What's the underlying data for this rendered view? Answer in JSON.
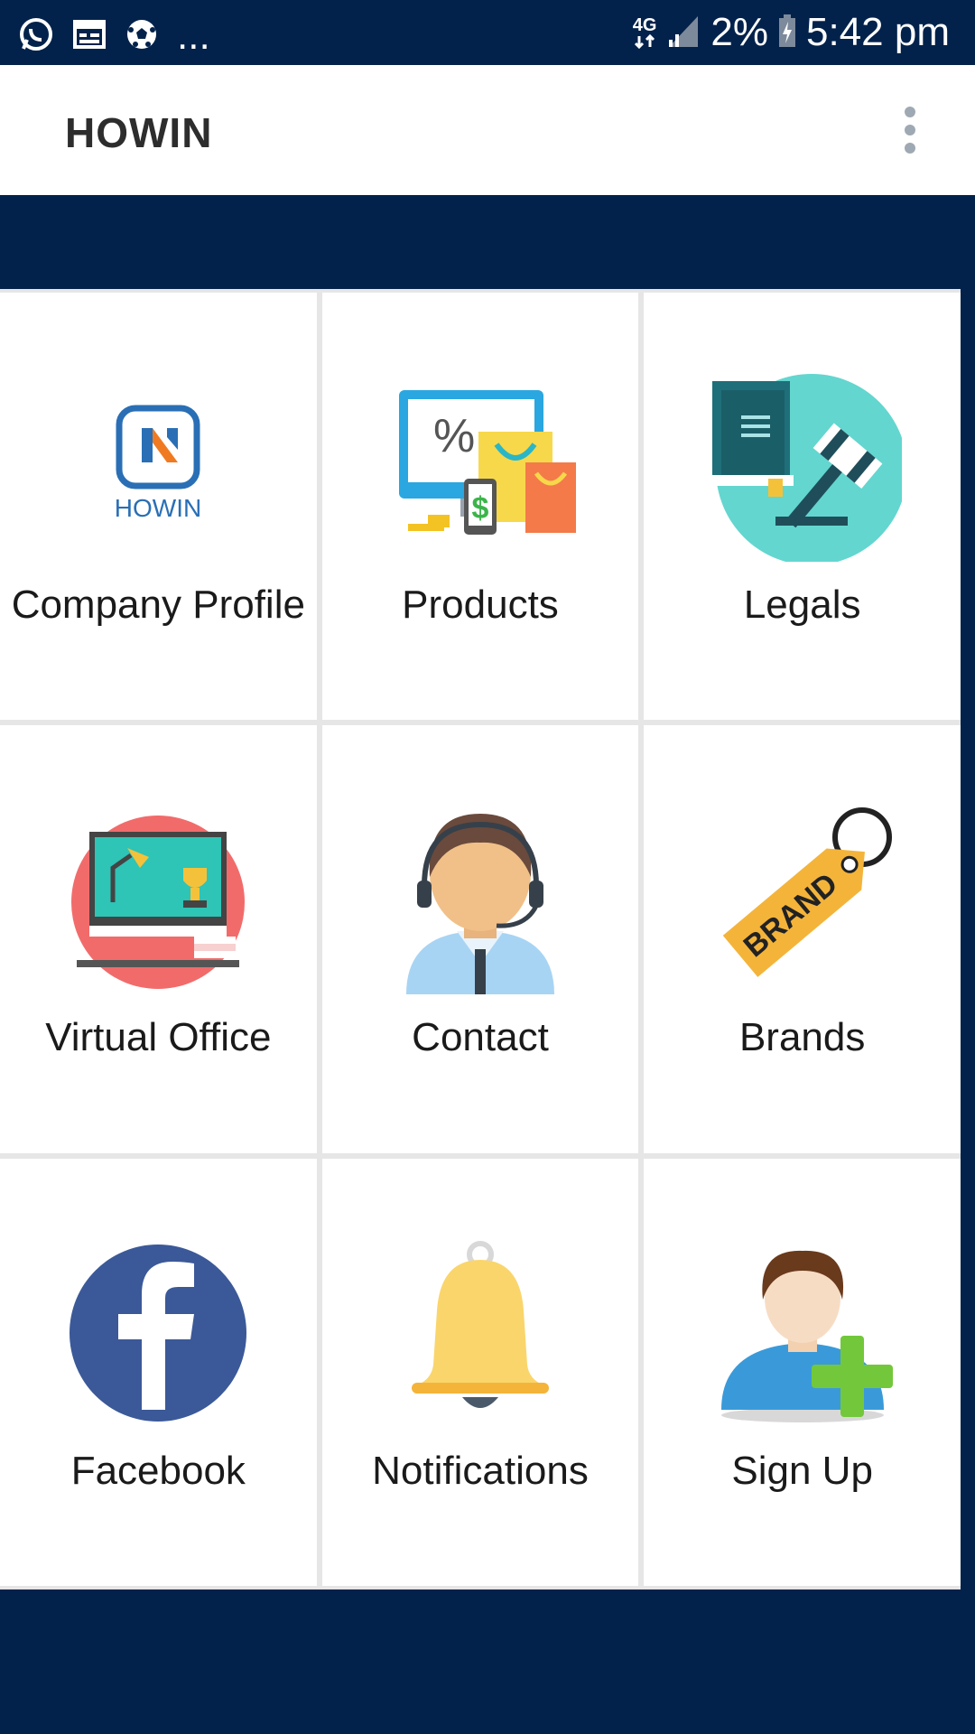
{
  "status_bar": {
    "network": "4G",
    "battery": "2%",
    "time": "5:42 pm",
    "more": "..."
  },
  "app_bar": {
    "title": "HOWIN"
  },
  "tiles": [
    {
      "label": "Company Profile",
      "icon": "howin-logo-icon"
    },
    {
      "label": "Products",
      "icon": "shopping-icon"
    },
    {
      "label": "Legals",
      "icon": "gavel-book-icon"
    },
    {
      "label": "Virtual Office",
      "icon": "desk-monitor-icon"
    },
    {
      "label": "Contact",
      "icon": "support-agent-icon"
    },
    {
      "label": "Brands",
      "icon": "brand-tag-icon"
    },
    {
      "label": "Facebook",
      "icon": "facebook-icon"
    },
    {
      "label": "Notifications",
      "icon": "bell-icon"
    },
    {
      "label": "Sign Up",
      "icon": "add-user-icon"
    }
  ],
  "logo_text": "HOWIN",
  "brand_tag_text": "BRAND",
  "colors": {
    "primary_dark": "#02224b",
    "tile_bg": "#ffffff",
    "grid_gap": "#e6e6e6"
  }
}
